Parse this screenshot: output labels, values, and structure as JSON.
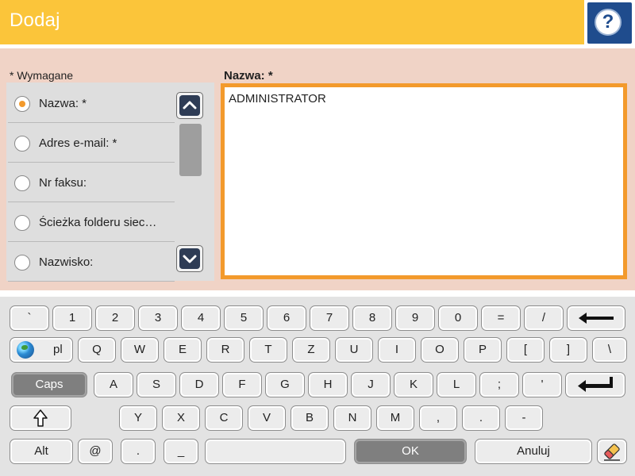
{
  "header": {
    "title": "Dodaj",
    "help_label": "?"
  },
  "form": {
    "required_note": "* Wymagane",
    "field_label": "Nazwa: *",
    "field_value": "ADMINISTRATOR",
    "fields": [
      {
        "label": "Nazwa: *",
        "selected": true
      },
      {
        "label": "Adres e-mail: *",
        "selected": false
      },
      {
        "label": "Nr faksu:",
        "selected": false
      },
      {
        "label": "Ścieżka folderu siec…",
        "selected": false
      },
      {
        "label": "Nazwisko:",
        "selected": false
      }
    ]
  },
  "keyboard": {
    "row1": [
      "`",
      "1",
      "2",
      "3",
      "4",
      "5",
      "6",
      "7",
      "8",
      "9",
      "0",
      "=",
      "/"
    ],
    "lang": "pl",
    "row2": [
      "Q",
      "W",
      "E",
      "R",
      "T",
      "Z",
      "U",
      "I",
      "O",
      "P",
      "[",
      "]",
      "\\"
    ],
    "caps": "Caps",
    "row3": [
      "A",
      "S",
      "D",
      "F",
      "G",
      "H",
      "J",
      "K",
      "L",
      ";",
      "'"
    ],
    "row4": [
      "Y",
      "X",
      "C",
      "V",
      "B",
      "N",
      "M",
      ",",
      ".",
      "-"
    ],
    "alt": "Alt",
    "at": "@",
    "dot": ".",
    "underscore": "_",
    "ok": "OK",
    "cancel": "Anuluj"
  },
  "colors": {
    "header": "#fbc53a",
    "help": "#1f4c8d",
    "form_bg": "#f0d3c6",
    "accent": "#f39a2c"
  }
}
